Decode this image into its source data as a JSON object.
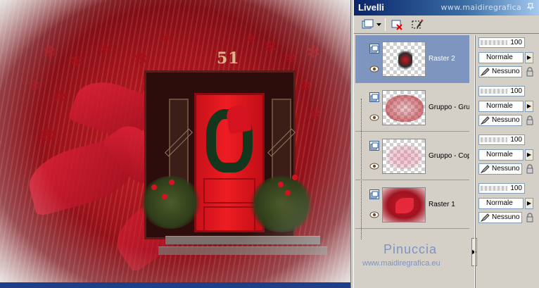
{
  "palette": {
    "title": "Livelli",
    "watermark": "www.maidiregrafica",
    "pin_icon": "pin-icon"
  },
  "toolbar": {
    "buttons": [
      "new-layer-icon",
      "dropdown-arrow-icon",
      "delete-layer-icon",
      "edit-selection-icon"
    ]
  },
  "layers": [
    {
      "name": "Raster 2",
      "selected": true,
      "opacity": "100",
      "blend": "Normale",
      "mask": "Nessuno"
    },
    {
      "name": "Gruppo - Grup",
      "selected": false,
      "opacity": "100",
      "blend": "Normale",
      "mask": "Nessuno"
    },
    {
      "name": "Gruppo - Copi",
      "selected": false,
      "opacity": "100",
      "blend": "Normale",
      "mask": "Nessuno"
    },
    {
      "name": "Raster 1",
      "selected": false,
      "opacity": "100",
      "blend": "Normale",
      "mask": "Nessuno"
    }
  ],
  "signature": {
    "name": "Pinuccia",
    "url": "www.maidiregrafica.eu"
  },
  "canvas": {
    "house_number": "51"
  },
  "colors": {
    "selected_layer": "#7d95bf",
    "titlebar": "#0a246a",
    "door": "#ee1d22",
    "signature": "#7f93c0"
  }
}
